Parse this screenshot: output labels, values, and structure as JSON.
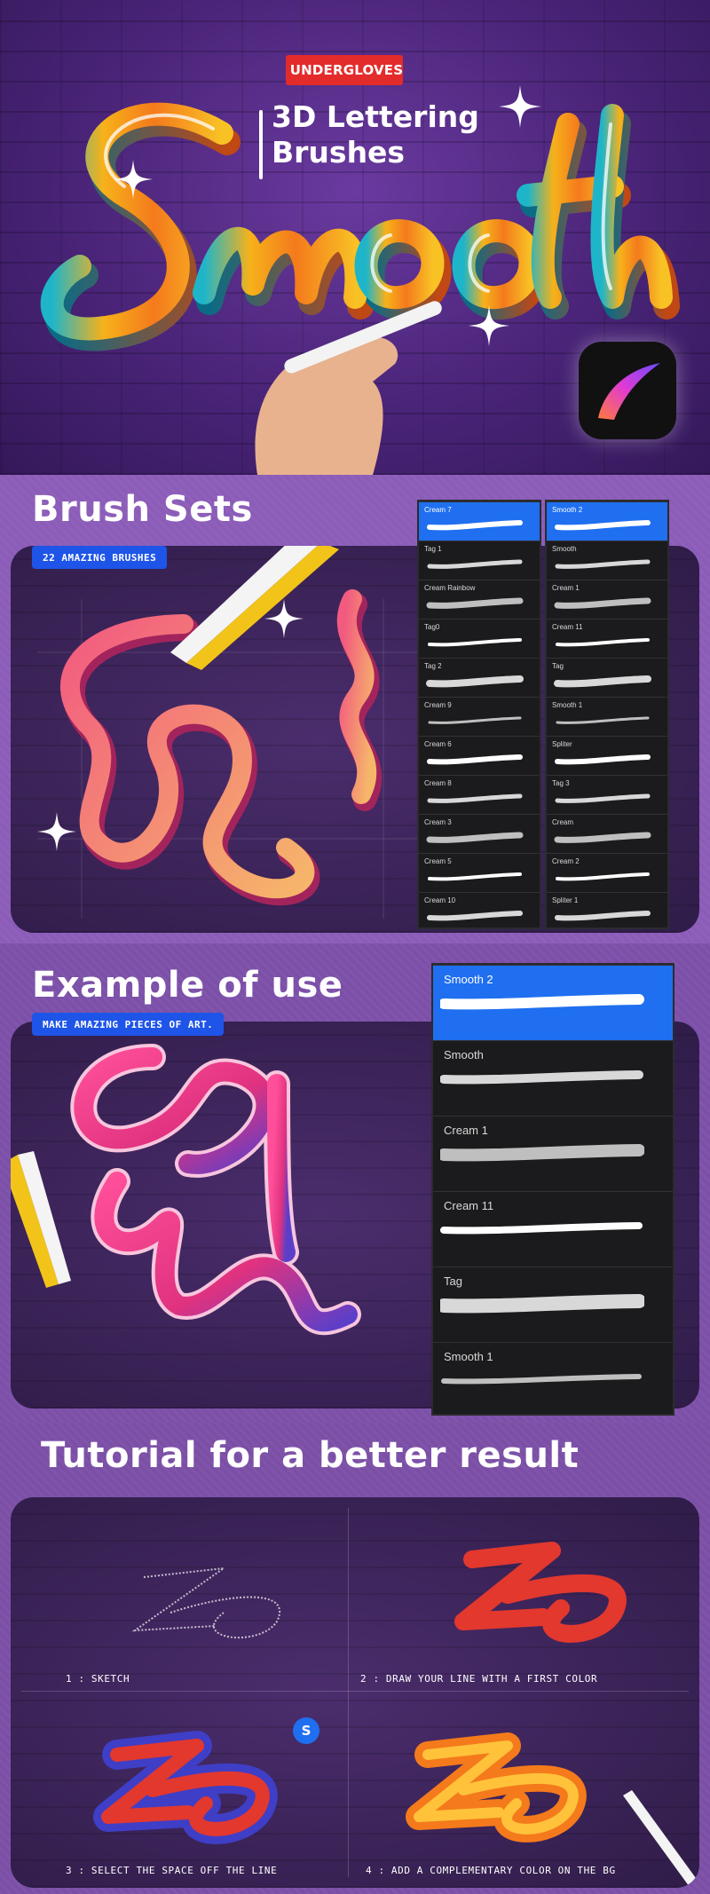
{
  "hero": {
    "brand": "UNDERGLOVES",
    "subtitle_line1": "3D Lettering",
    "subtitle_line2": "Brushes",
    "word_art": "Smooth",
    "app_icon": "procreate-app-icon"
  },
  "brush_sets": {
    "title": "Brush Sets",
    "chip": "22 AMAZING BRUSHES",
    "left_column": [
      "Cream 7",
      "Tag 1",
      "Cream Rainbow",
      "Tag0",
      "Tag 2",
      "Cream 9",
      "Cream 6",
      "Cream 8",
      "Cream 3",
      "Cream 5",
      "Cream 10"
    ],
    "right_column": [
      "Smooth 2",
      "Smooth",
      "Cream 1",
      "Cream 11",
      "Tag",
      "Smooth 1",
      "Spliter",
      "Tag 3",
      "Cream",
      "Cream 2",
      "Spliter 1"
    ]
  },
  "example": {
    "title": "Example of use",
    "chip": "MAKE AMAZING PIECES OF ART.",
    "brushes": [
      "Smooth 2",
      "Smooth",
      "Cream 1",
      "Cream 11",
      "Tag",
      "Smooth 1"
    ]
  },
  "tutorial": {
    "title": "Tutorial for a better result",
    "steps": [
      "1 : SKETCH",
      "2 : DRAW YOUR LINE WITH A FIRST COLOR",
      "3 : SELECT THE SPACE OFF THE LINE",
      "4 : ADD A COMPLEMENTARY COLOR ON THE BG"
    ],
    "selection_badge": "S"
  },
  "colors": {
    "purple_bg": "#8b5cb8",
    "dark_panel": "#2f1c48",
    "accent_blue": "#1f6ff0",
    "brand_red": "#e32b2b"
  }
}
